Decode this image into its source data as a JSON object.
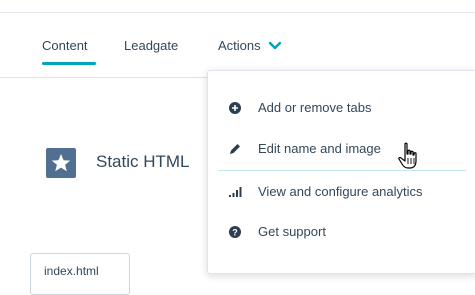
{
  "tabs": {
    "content": "Content",
    "leadgate": "Leadgate",
    "actions": "Actions"
  },
  "module": {
    "title": "Static HTML",
    "icon": "star-icon"
  },
  "file_tab": {
    "label": "index.html"
  },
  "actions_menu": {
    "items": [
      {
        "label": "Add or remove tabs",
        "icon": "plus-circle-icon"
      },
      {
        "label": "Edit name and image",
        "icon": "pencil-icon"
      },
      {
        "label": "View and configure analytics",
        "icon": "bar-chart-icon"
      },
      {
        "label": "Get support",
        "icon": "question-circle-icon"
      }
    ]
  },
  "colors": {
    "accent": "#00a4bd",
    "text": "#33475b",
    "module_icon_bg": "#516f90",
    "border": "#dfe3eb"
  }
}
